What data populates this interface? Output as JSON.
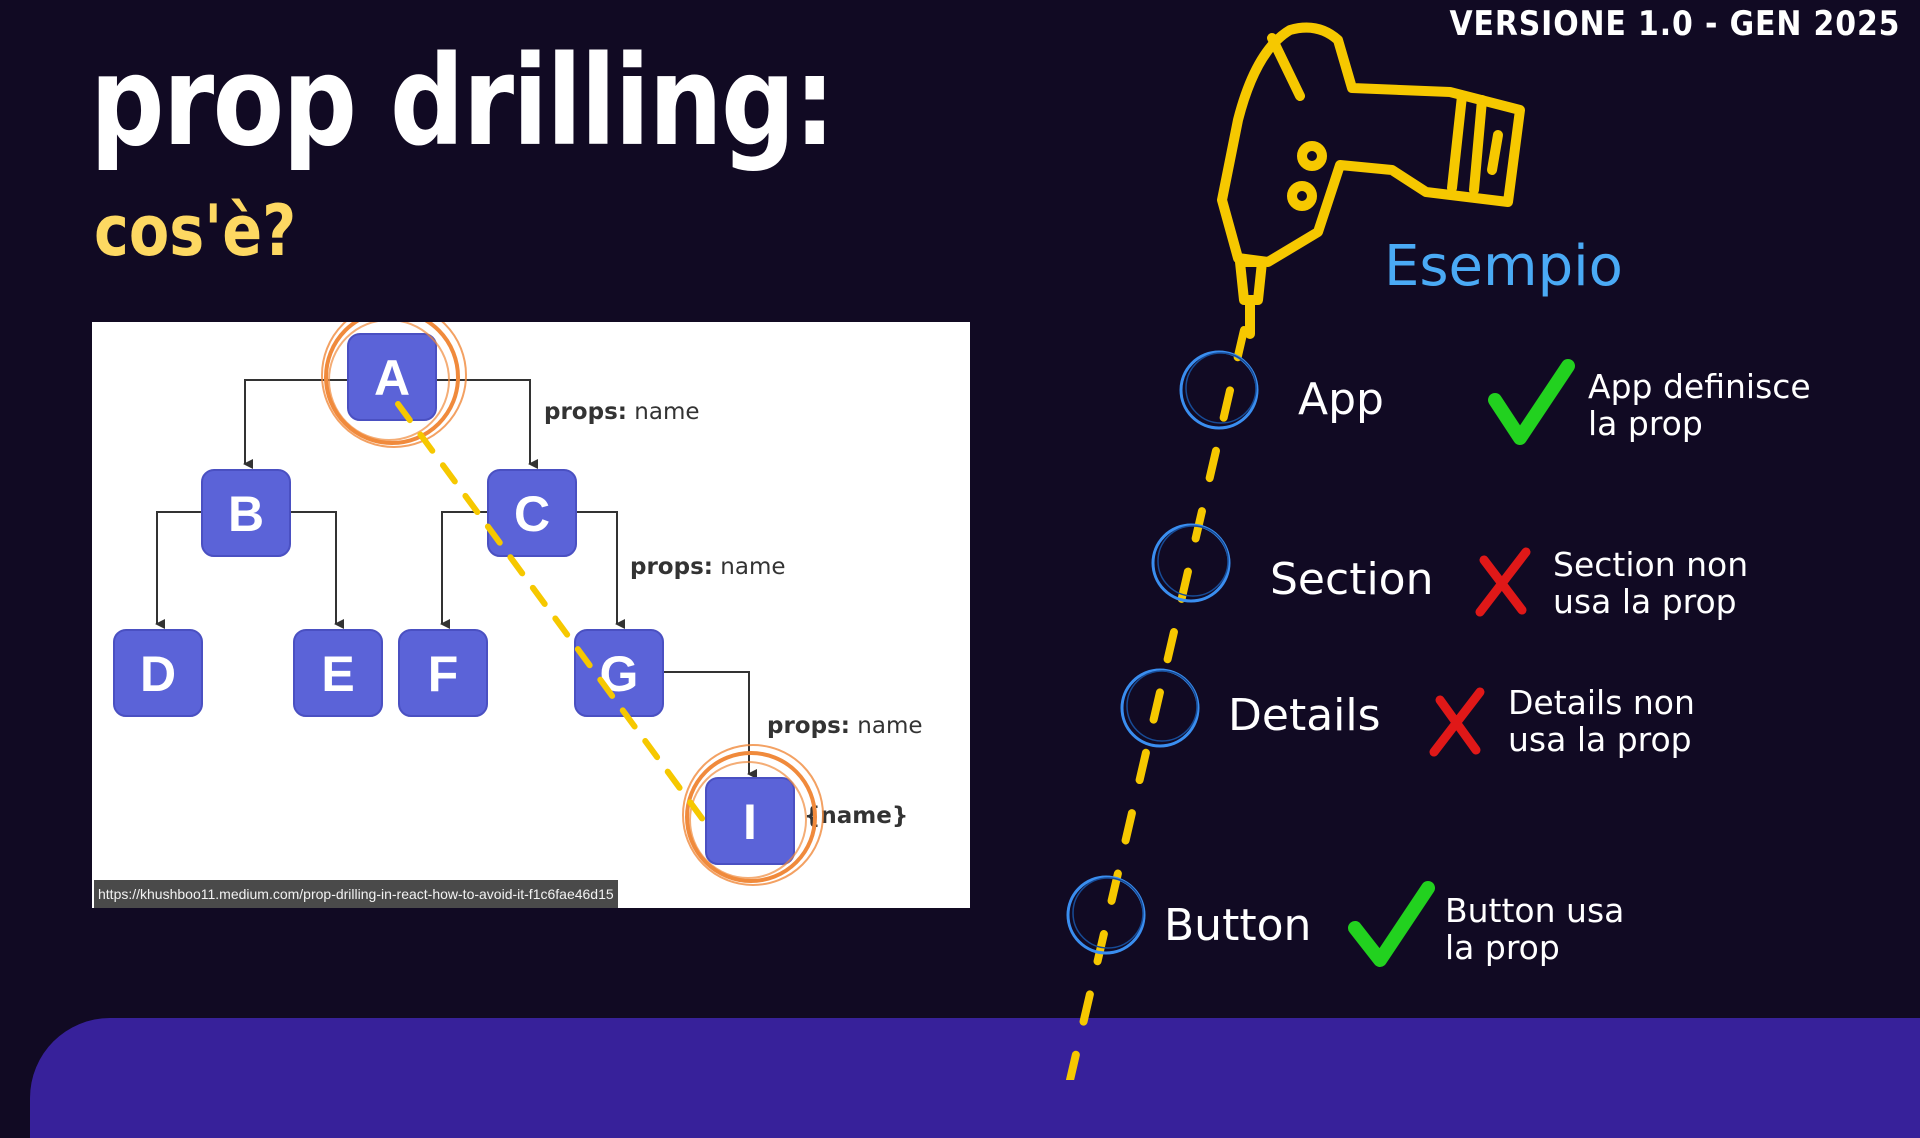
{
  "version": "VERSIONE 1.0 - GEN 2025",
  "title": "prop drilling:",
  "subtitle": "cos'è?",
  "diagram": {
    "nodes": [
      "A",
      "B",
      "C",
      "D",
      "E",
      "F",
      "G",
      "I"
    ],
    "prop_label_key": "props:",
    "prop_label_value": "name",
    "leaf_annotation": "{name}",
    "source_url": "https://khushboo11.medium.com/prop-drilling-in-react-how-to-avoid-it-f1c6fae46d15"
  },
  "example": {
    "heading": "Esempio",
    "steps": [
      {
        "name": "App",
        "status": "check",
        "note_line1": "App definisce",
        "note_line2": "la prop"
      },
      {
        "name": "Section",
        "status": "cross",
        "note_line1": "Section non",
        "note_line2": "usa la prop"
      },
      {
        "name": "Details",
        "status": "cross",
        "note_line1": "Details non",
        "note_line2": "usa la prop"
      },
      {
        "name": "Button",
        "status": "check",
        "note_line1": "Button usa",
        "note_line2": "la prop"
      }
    ]
  },
  "colors": {
    "background": "#110a23",
    "subtitle": "#fdd862",
    "accent_yellow": "#f6c800",
    "node_fill": "#5b63d8",
    "highlight_ring": "#f08a3c",
    "esempio": "#4aaaf5",
    "check": "#22d11f",
    "cross": "#e01818",
    "band": "#37219a"
  },
  "icons": [
    "drill-icon",
    "check-icon",
    "cross-icon",
    "circle-marker-icon"
  ]
}
